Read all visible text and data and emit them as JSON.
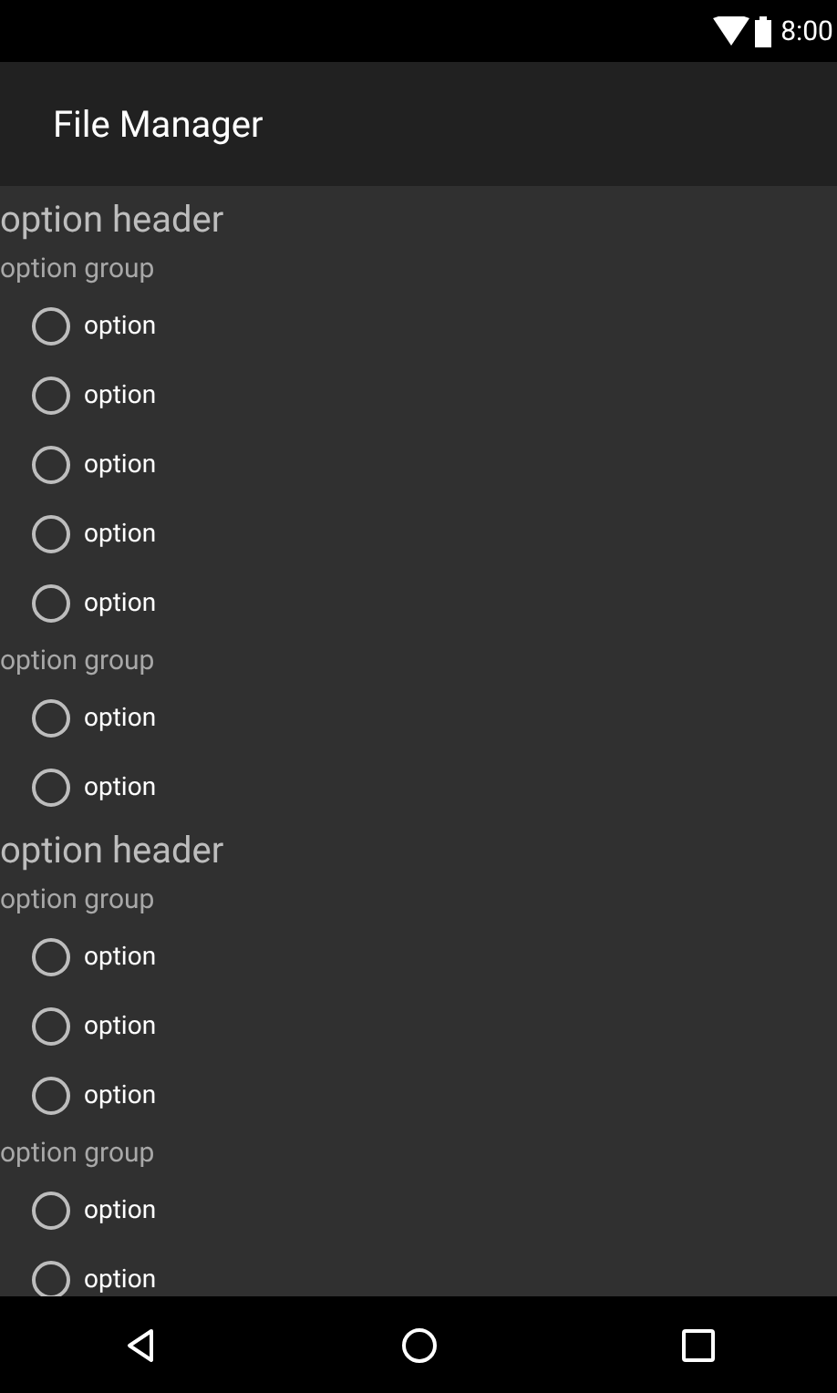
{
  "status_bar": {
    "time": "8:00"
  },
  "app_bar": {
    "title": "File Manager"
  },
  "sections": [
    {
      "header": "option header",
      "groups": [
        {
          "label": "option group",
          "options": [
            {
              "label": "option",
              "selected": false
            },
            {
              "label": "option",
              "selected": false
            },
            {
              "label": "option",
              "selected": false
            },
            {
              "label": "option",
              "selected": false
            },
            {
              "label": "option",
              "selected": false
            }
          ]
        },
        {
          "label": "option group",
          "options": [
            {
              "label": "option",
              "selected": false
            },
            {
              "label": "option",
              "selected": false
            }
          ]
        }
      ]
    },
    {
      "header": "option header",
      "groups": [
        {
          "label": "option group",
          "options": [
            {
              "label": "option",
              "selected": false
            },
            {
              "label": "option",
              "selected": false
            },
            {
              "label": "option",
              "selected": false
            }
          ]
        },
        {
          "label": "option group",
          "options": [
            {
              "label": "option",
              "selected": false
            },
            {
              "label": "option",
              "selected": false
            }
          ]
        }
      ]
    }
  ]
}
